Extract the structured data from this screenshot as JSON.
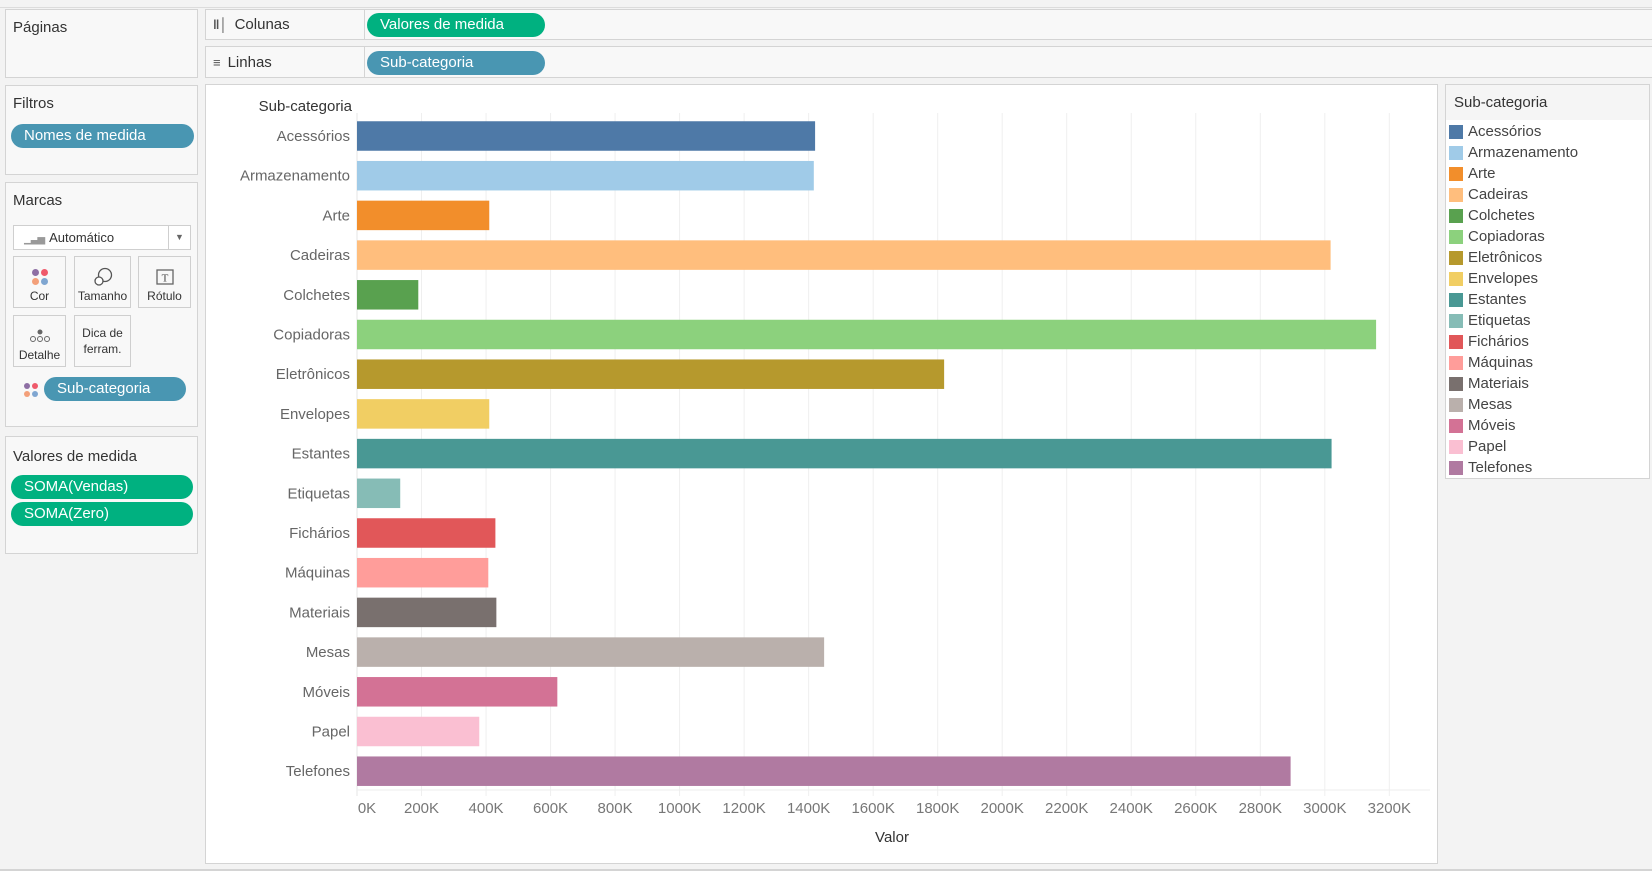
{
  "shelves": {
    "pages_title": "Páginas",
    "columns_label": "Colunas",
    "columns_icon": "columns-icon",
    "columns_pill": "Valores de medida",
    "rows_label": "Linhas",
    "rows_icon": "rows-icon",
    "rows_pill": "Sub-categoria"
  },
  "filters": {
    "title": "Filtros",
    "pill": "Nomes de medida"
  },
  "marks": {
    "title": "Marcas",
    "type_value": "Automático",
    "cards": [
      {
        "label": "Cor",
        "icon": "color-icon"
      },
      {
        "label": "Tamanho",
        "icon": "size-icon"
      },
      {
        "label": "Rótulo",
        "icon": "label-icon"
      },
      {
        "label": "Detalhe",
        "icon": "detail-icon"
      },
      {
        "label": "Dica de ferram.",
        "icon": "tooltip-icon"
      }
    ],
    "color_pill": "Sub-categoria"
  },
  "measure_values": {
    "title": "Valores de medida",
    "pills": [
      "SOMA(Vendas)",
      "SOMA(Zero)"
    ]
  },
  "colors": {
    "green_pill": "#00b180",
    "blue_pill": "#4996b2",
    "dots": [
      "#8e6fa4",
      "#ef5a6b",
      "#f3a07a",
      "#7fa6d1"
    ]
  },
  "chart_data": {
    "type": "bar",
    "orientation": "horizontal",
    "title": "",
    "ylabel": "Sub-categoria",
    "xlabel": "Valor",
    "categories": [
      "Acessórios",
      "Armazenamento",
      "Arte",
      "Cadeiras",
      "Colchetes",
      "Copiadoras",
      "Eletrônicos",
      "Envelopes",
      "Estantes",
      "Etiquetas",
      "Fichários",
      "Máquinas",
      "Materiais",
      "Mesas",
      "Móveis",
      "Papel",
      "Telefones"
    ],
    "values": [
      1420000,
      1416000,
      410000,
      3018000,
      190000,
      3159000,
      1820000,
      410000,
      3021000,
      134000,
      429000,
      407000,
      432000,
      1448000,
      621000,
      379000,
      2894000
    ],
    "bar_colors": [
      "#4e79a7",
      "#a0cbe8",
      "#f28e2b",
      "#ffbe7d",
      "#59a14f",
      "#8cd17d",
      "#b6992d",
      "#f1ce63",
      "#499894",
      "#86bcb6",
      "#e15759",
      "#ff9d9a",
      "#79706e",
      "#bab0ac",
      "#d37295",
      "#fabfd2",
      "#b07aa1"
    ],
    "xlim": [
      0,
      3330000
    ],
    "xticks": [
      0,
      200000,
      400000,
      600000,
      800000,
      1000000,
      1200000,
      1400000,
      1600000,
      1800000,
      2000000,
      2200000,
      2400000,
      2600000,
      2800000,
      3000000,
      3200000
    ],
    "xtick_labels": [
      "0K",
      "200K",
      "400K",
      "600K",
      "800K",
      "1000K",
      "1200K",
      "1400K",
      "1600K",
      "1800K",
      "2000K",
      "2200K",
      "2400K",
      "2600K",
      "2800K",
      "3000K",
      "3200K"
    ],
    "grid": true,
    "legend": {
      "title": "Sub-categoria",
      "position": "right"
    }
  }
}
